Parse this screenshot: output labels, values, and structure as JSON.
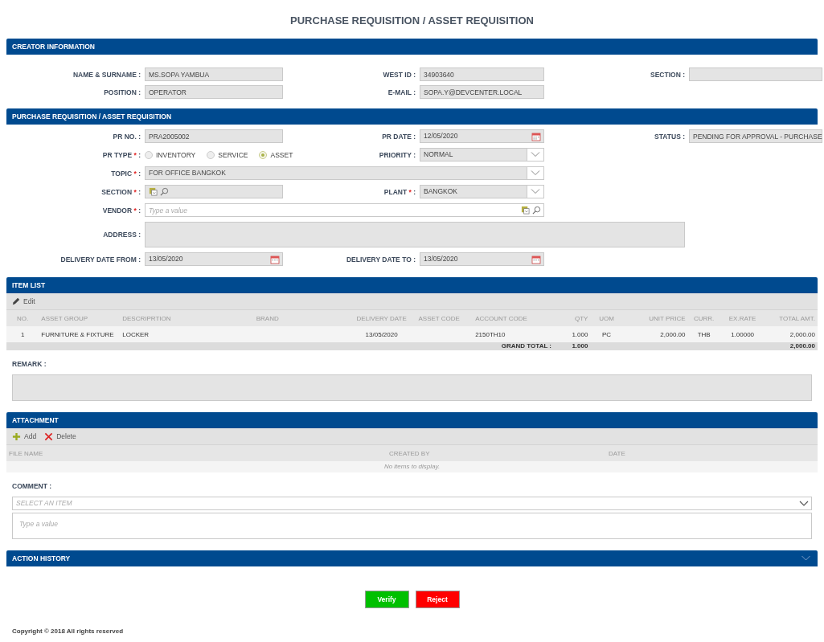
{
  "title": "PURCHASE  REQUISITION / ASSET REQUISITION",
  "creator": {
    "title": "CREATOR INFORMATION",
    "name": {
      "label": "NAME & SURNAME :",
      "value": "MS.SOPA YAMBUA"
    },
    "west_id": {
      "label": "WEST ID :",
      "value": "34903640"
    },
    "section": {
      "label": "SECTION :"
    },
    "position": {
      "label": "POSITION :",
      "value": "OPERATOR"
    },
    "email": {
      "label": "E-MAIL :",
      "value": "SOPA.Y@DEVCENTER.LOCAL"
    }
  },
  "purchase": {
    "title": "PURCHASE REQUISITION / ASSET REQUISITION",
    "pr_no": {
      "label": "PR NO. :",
      "value": "PRA2005002"
    },
    "pr_date": {
      "label": "PR DATE :",
      "value": "12/05/2020"
    },
    "status": {
      "label": "STATUS :",
      "value": "PENDING FOR APPROVAL - PURCHASE"
    },
    "pr_type": {
      "label": "PR TYPE",
      "required_mark": "*",
      "colon": ":",
      "options": [
        {
          "label": "INVENTORY",
          "selected": false
        },
        {
          "label": "SERVICE",
          "selected": false
        },
        {
          "label": "ASSET",
          "selected": true
        }
      ]
    },
    "priority": {
      "label": "PRIORITY :",
      "value": "NORMAL"
    },
    "topic": {
      "label": "TOPIC",
      "required_mark": "*",
      "colon": ":",
      "value": "FOR OFFICE BANGKOK"
    },
    "section": {
      "label": "SECTION",
      "required_mark": "*",
      "colon": ":"
    },
    "plant": {
      "label": "PLANT",
      "required_mark": "*",
      "colon": ":",
      "value": "BANGKOK"
    },
    "vendor": {
      "label": "VENDOR",
      "required_mark": "*",
      "colon": ":",
      "placeholder": "Type a value"
    },
    "address": {
      "label": "ADDRESS :"
    },
    "delivery_from": {
      "label": "DELIVERY DATE FROM :",
      "value": "13/05/2020"
    },
    "delivery_to": {
      "label": "DELIVERY DATE TO :",
      "value": "13/05/2020"
    }
  },
  "item_list": {
    "title": "ITEM LIST",
    "toolbar": [
      "Edit"
    ],
    "columns": [
      "NO.",
      "ASSET GROUP",
      "DESCRIPRTION",
      "BRAND",
      "DELIVERY DATE",
      "ASSET CODE",
      "ACCOUNT CODE",
      "QTY",
      "UOM",
      "UNIT PRICE",
      "CURR.",
      "EX.RATE",
      "TOTAL AMT."
    ],
    "rows": [
      [
        "1",
        "FURNITURE & FIXTURE",
        "LOCKER",
        "",
        "13/05/2020",
        "",
        "2150TH10",
        "1.000",
        "PC",
        "2,000.00",
        "THB",
        "1.00000",
        "2,000.00"
      ]
    ],
    "grand_total": {
      "label": "GRAND TOTAL :",
      "qty": "1.000",
      "total": "2,000.00"
    }
  },
  "remark": {
    "label": "REMARK :"
  },
  "attachment": {
    "title": "ATTACHMENT",
    "toolbar": [
      {
        "kind": "add",
        "label": "Add"
      },
      {
        "kind": "delete",
        "label": "Delete"
      }
    ],
    "columns": [
      "FILE NAME",
      "CREATED BY",
      "DATE"
    ],
    "empty_message": "No items to display."
  },
  "comment": {
    "label": "COMMENT :",
    "select_placeholder": "SELECT AN ITEM",
    "text_placeholder": "Type a value"
  },
  "action_history": {
    "title": "ACTION HISTORY",
    "expanded": false
  },
  "buttons": [
    {
      "kind": "approve",
      "label": "Verify"
    },
    {
      "kind": "reject",
      "label": "Reject"
    }
  ],
  "footer": "Copyright © 2018 All rights reserved"
}
